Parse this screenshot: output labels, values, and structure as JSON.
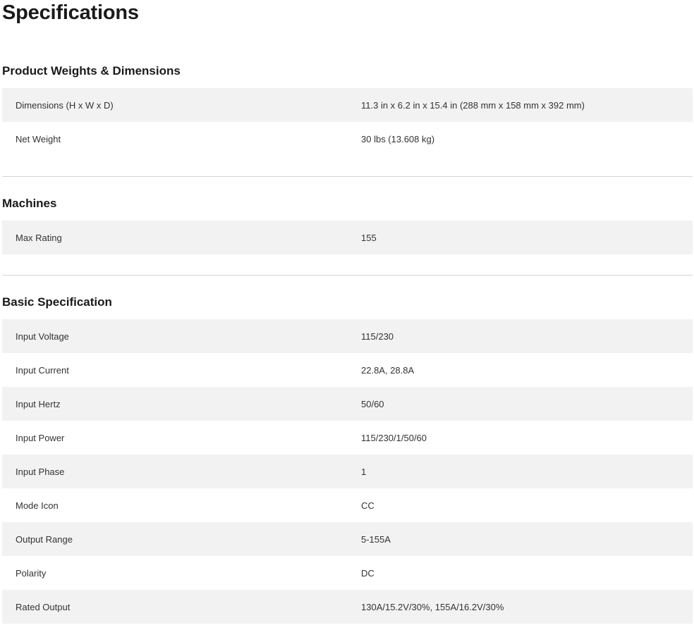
{
  "page": {
    "title": "Specifications"
  },
  "sections": [
    {
      "title": "Product Weights & Dimensions",
      "rows": [
        {
          "label": "Dimensions (H x W x D)",
          "value": "11.3 in x 6.2 in x 15.4 in (288 mm x 158 mm x 392 mm)"
        },
        {
          "label": "Net Weight",
          "value": "30 lbs (13.608 kg)"
        }
      ]
    },
    {
      "title": "Machines",
      "rows": [
        {
          "label": "Max Rating",
          "value": "155"
        }
      ]
    },
    {
      "title": "Basic Specification",
      "rows": [
        {
          "label": "Input Voltage",
          "value": "115/230"
        },
        {
          "label": "Input Current",
          "value": "22.8A, 28.8A"
        },
        {
          "label": "Input Hertz",
          "value": "50/60"
        },
        {
          "label": "Input Power",
          "value": "115/230/1/50/60"
        },
        {
          "label": "Input Phase",
          "value": "1"
        },
        {
          "label": "Mode Icon",
          "value": "CC"
        },
        {
          "label": "Output Range",
          "value": "5-155A"
        },
        {
          "label": "Polarity",
          "value": "DC"
        },
        {
          "label": "Rated Output",
          "value": "130A/15.2V/30%, 155A/16.2V/30%"
        }
      ]
    }
  ]
}
